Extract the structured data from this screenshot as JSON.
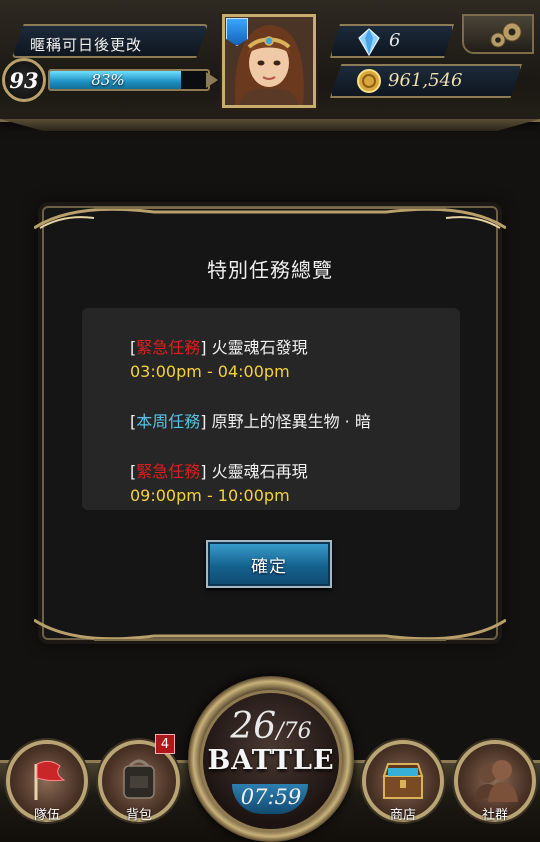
{
  "player": {
    "name": "暱稱可日後更改",
    "level": "93",
    "exp_percent_label": "83%",
    "exp_fraction": 0.83,
    "gems": "6",
    "gold": "961,546"
  },
  "dialog": {
    "title": "特別任務總覽",
    "missions": [
      {
        "tag": "緊急任務",
        "tag_color": "#e11d1d",
        "name": "火靈魂石發現",
        "time": "03:00pm - 04:00pm"
      },
      {
        "tag": "本周任務",
        "tag_color": "#56c3e6",
        "name": "原野上的怪異生物 · 暗",
        "time": ""
      },
      {
        "tag": "緊急任務",
        "tag_color": "#e11d1d",
        "name": "火靈魂石再現",
        "time": "09:00pm - 10:00pm"
      }
    ],
    "confirm_label": "確定"
  },
  "nav": {
    "team_label": "隊伍",
    "bag_label": "背包",
    "bag_badge": "4",
    "shop_label": "商店",
    "social_label": "社群"
  },
  "battle": {
    "current": "26",
    "max": "/76",
    "label": "BATTLE",
    "timer": "07:59"
  },
  "colors": {
    "accent_gold": "#8d7b55",
    "exp_blue": "#1d8fc0",
    "urgent_red": "#e11d1d",
    "weekly_cyan": "#56c3e6",
    "time_yellow": "#f5d23a"
  },
  "icons": [
    "gear-icon",
    "diamond-icon",
    "coin-icon",
    "flag-icon",
    "backpack-icon",
    "treasure-chest-icon",
    "people-icon"
  ]
}
